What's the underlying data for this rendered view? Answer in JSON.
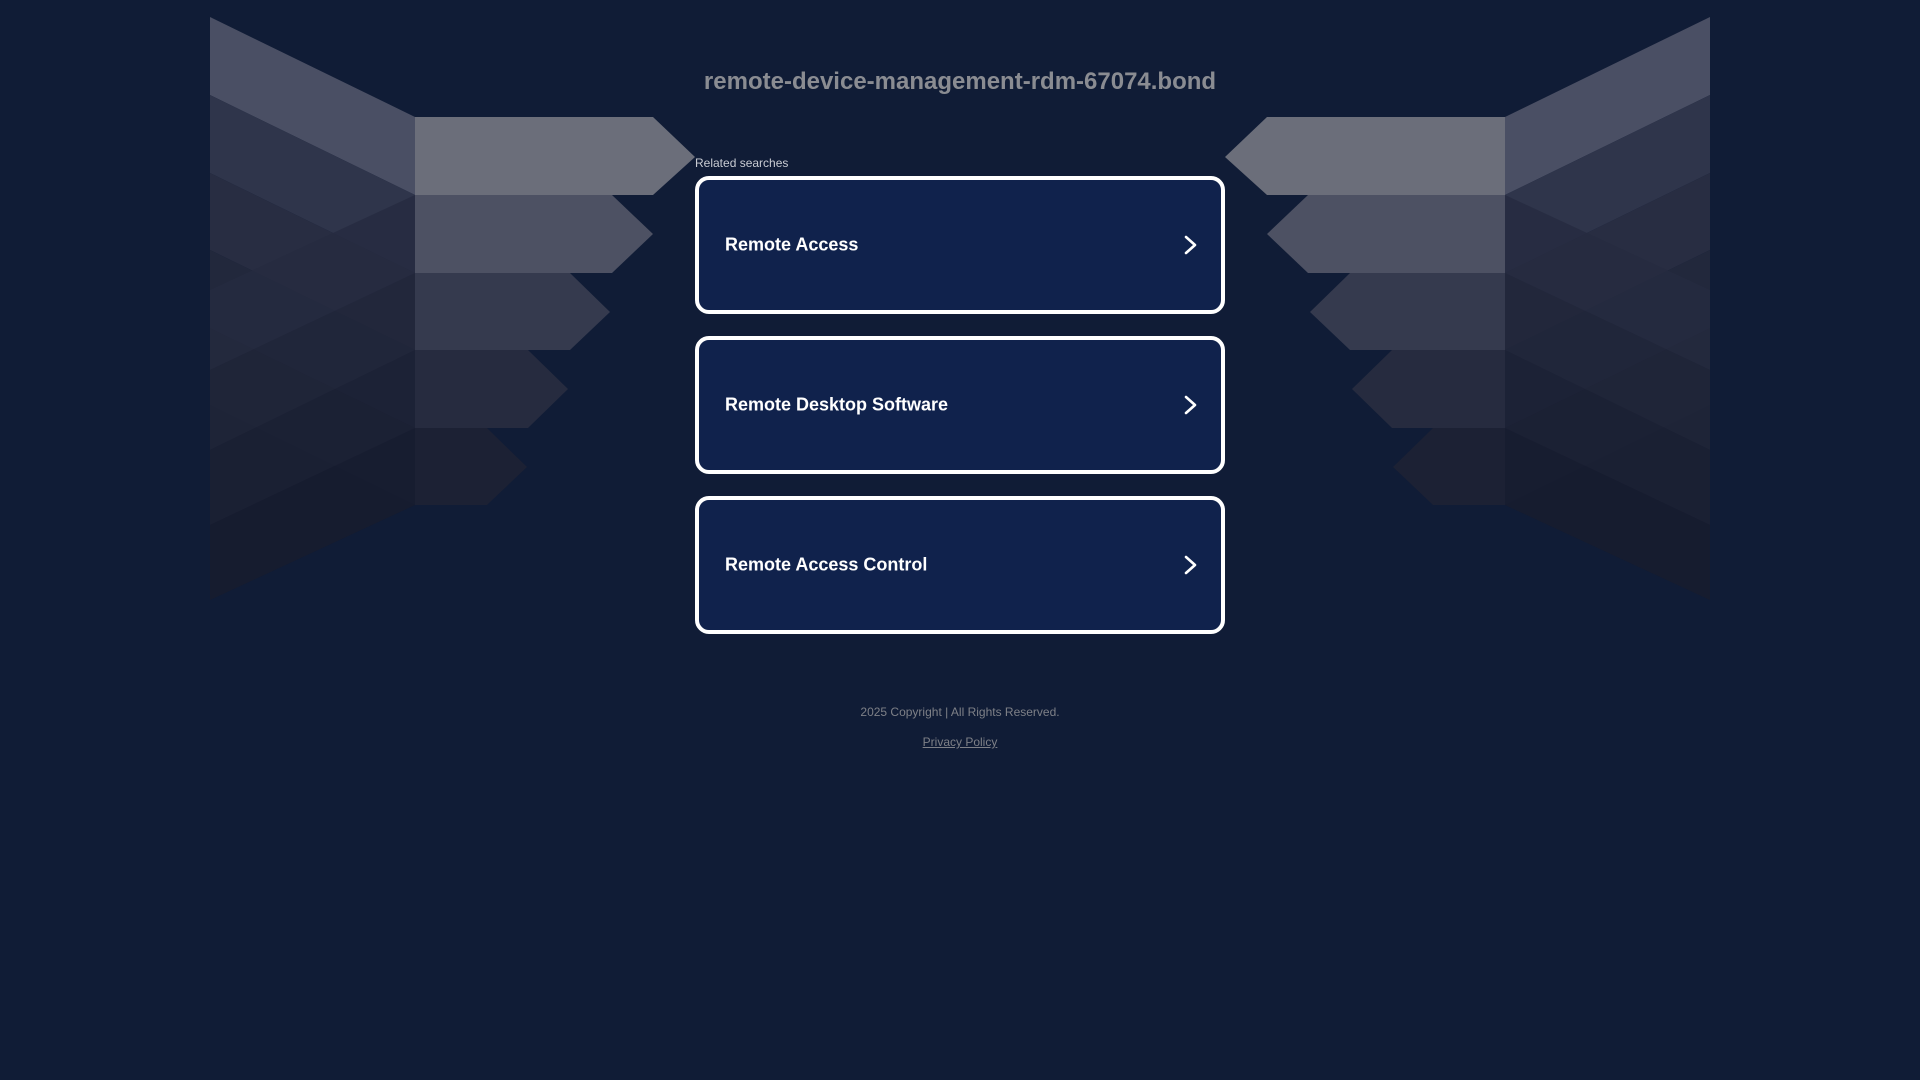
{
  "page": {
    "domain_title": "remote-device-management-rdm-67074.bond",
    "related_label": "Related searches"
  },
  "searches": [
    {
      "label": "Remote Access",
      "icon": "chevron-right-icon"
    },
    {
      "label": "Remote Desktop Software",
      "icon": "chevron-right-icon"
    },
    {
      "label": "Remote Access Control",
      "icon": "chevron-right-icon"
    }
  ],
  "footer": {
    "copyright": "2025 Copyright | All Rights Reserved.",
    "privacy_link": "Privacy Policy"
  },
  "colors": {
    "background": "#101c36",
    "card_background": "#10224c",
    "card_border": "#ffffff",
    "title_text": "#8a8c92"
  }
}
